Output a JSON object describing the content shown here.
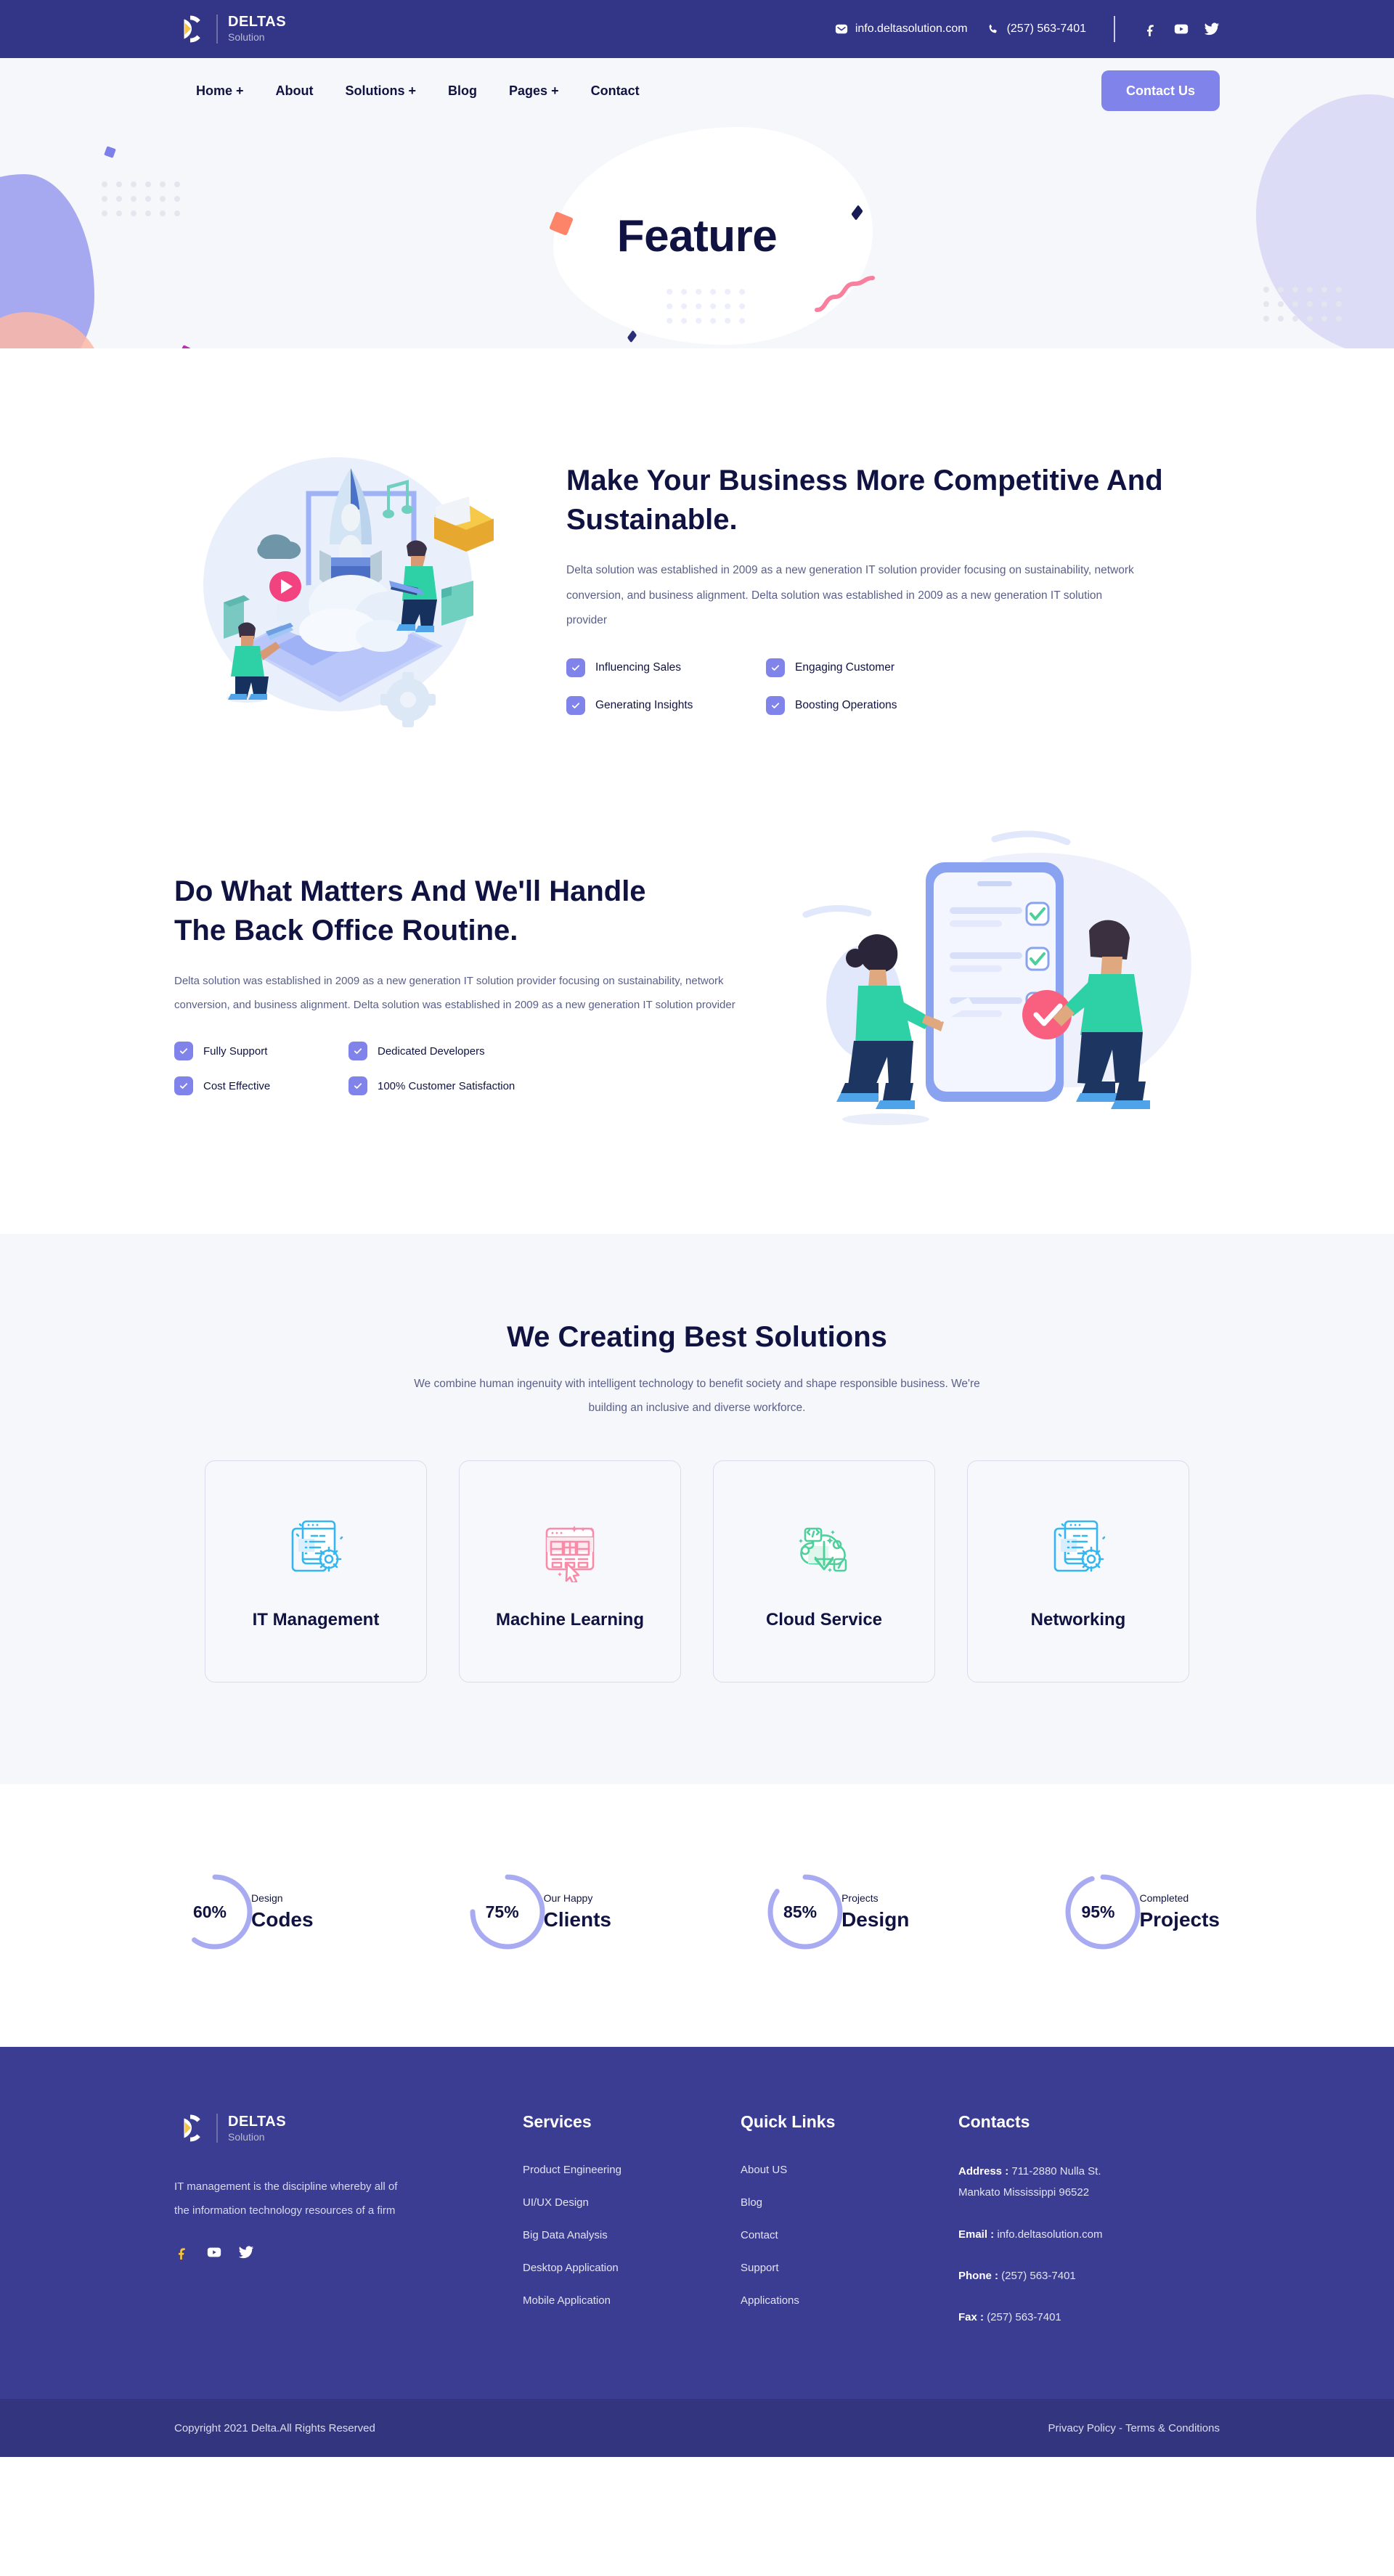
{
  "brand": {
    "name": "DELTAS",
    "sub": "Solution"
  },
  "topbar": {
    "email": "info.deltasolution.com",
    "phone": "(257) 563-7401",
    "email_icon": "envelope-icon",
    "phone_icon": "phone-icon",
    "socials": [
      "facebook-icon",
      "youtube-icon",
      "twitter-icon"
    ]
  },
  "nav": {
    "links": [
      "Home +",
      "About",
      "Solutions +",
      "Blog",
      "Pages +",
      "Contact"
    ],
    "cta": "Contact Us"
  },
  "hero": {
    "title": "Feature"
  },
  "section_one": {
    "heading": "Make Your Business More Competitive And Sustainable.",
    "paragraph": "Delta solution was established in 2009 as a new generation IT solution provider focusing on sustainability, network conversion, and business alignment. Delta solution was established in 2009 as a new generation IT solution provider",
    "checks": [
      "Influencing Sales",
      "Engaging Customer",
      "Generating Insights",
      "Boosting Operations"
    ],
    "illustration": "rocket-launch-laptop-illustration"
  },
  "section_two": {
    "heading": "Do What Matters And We'll Handle The Back Office Routine.",
    "paragraph": "Delta solution was established in 2009 as a new generation IT solution provider focusing on sustainability, network conversion, and business alignment. Delta solution was established in 2009 as a new generation IT solution provider",
    "checks": [
      "Fully Support",
      "Dedicated Developers",
      "Cost Effective",
      "100% Customer Satisfaction"
    ],
    "illustration": "mobile-checklist-people-illustration"
  },
  "solutions": {
    "title": "We Creating Best Solutions",
    "subtitle": "We combine human ingenuity with intelligent technology to benefit society and shape responsible business. We're building an inclusive and diverse workforce.",
    "cards": [
      {
        "label": "IT Management",
        "icon": "document-gear-icon",
        "color": "#35b6f0"
      },
      {
        "label": "Machine Learning",
        "icon": "browser-cursor-icon",
        "color": "#f98aa8"
      },
      {
        "label": "Cloud Service",
        "icon": "cloud-download-icon",
        "color": "#4ecf9b"
      },
      {
        "label": "Networking",
        "icon": "document-gear-icon",
        "color": "#35b6f0"
      }
    ]
  },
  "chart_data": {
    "type": "pie",
    "title": "Company statistics progress rings",
    "series": [
      {
        "name": "Design Codes",
        "value": 60,
        "label": "60%",
        "top": "Design",
        "bottom": "Codes"
      },
      {
        "name": "Our Happy Clients",
        "value": 75,
        "label": "75%",
        "top": "Our Happy",
        "bottom": "Clients"
      },
      {
        "name": "Projects Design",
        "value": 85,
        "label": "85%",
        "top": "Projects",
        "bottom": "Design"
      },
      {
        "name": "Completed Projects",
        "value": 95,
        "label": "95%",
        "top": "Completed",
        "bottom": "Projects"
      }
    ],
    "max": 100,
    "track_color": "#ffffff",
    "arc_color": "#a9abf2"
  },
  "footer": {
    "description": "IT management is the discipline whereby all of the information technology resources of a firm",
    "socials": [
      "facebook-icon",
      "youtube-icon",
      "twitter-icon"
    ],
    "services": {
      "head": "Services",
      "items": [
        "Product Engineering",
        "UI/UX Design",
        "Big Data Analysis",
        "Desktop Application",
        "Mobile Application"
      ]
    },
    "quick_links": {
      "head": "Quick Links",
      "items": [
        "About  US",
        "Blog",
        "Contact",
        "Support",
        "Applications"
      ]
    },
    "contacts": {
      "head": "Contacts",
      "address_label": "Address :",
      "address_value": "711-2880 Nulla St.",
      "address_value2": "Mankato Mississippi 96522",
      "email_label": "Email :",
      "email_value": "info.deltasolution.com",
      "phone_label": "Phone :",
      "phone_value": "(257) 563-7401",
      "fax_label": "Fax :",
      "fax_value": "(257) 563-7401"
    }
  },
  "copyright": {
    "left": "Copyright 2021 Delta.All Rights Reserved",
    "right": "Privacy Policy - Terms & Conditions"
  },
  "colors": {
    "topbar": "#333586",
    "footer": "#3b3d93",
    "copybar": "#33357f",
    "accent": "#8083ea",
    "navy": "#101341",
    "muted": "#5a5f8a",
    "hero_bg": "#f5f7fa"
  }
}
